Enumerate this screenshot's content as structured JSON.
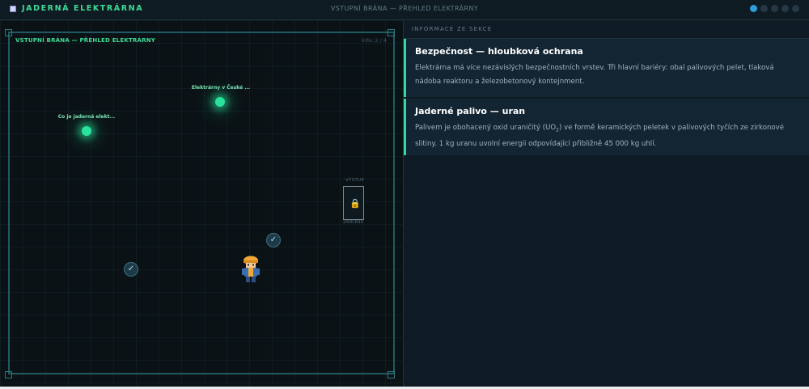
{
  "header": {
    "brand": "JADERNÁ ELEKTRÁRNA",
    "center_title": "VSTUPNÍ BRÁNA — PŘEHLED ELEKTRÁRNY",
    "progress_dots_total": 5,
    "progress_dots_active": 1
  },
  "game": {
    "arena_title": "VSTUPNÍ BRÁNA — PŘEHLED ELEKTRÁRNY",
    "info_label": "Info:",
    "info_count": "2 / 4",
    "nodes": [
      {
        "label": "Co je jaderná elekt...",
        "state": "active"
      },
      {
        "label": "Elektrárny v České ...",
        "state": "active"
      }
    ],
    "completed_markers": 2,
    "exit": {
      "label": "VÝSTUP",
      "status": "ZAMČENO",
      "icon": "lock-icon"
    },
    "player_icon": "worker-avatar"
  },
  "panel": {
    "header": "INFORMACE ZE SEKCE",
    "cards": [
      {
        "title": "Bezpečnost — hloubková ochrana",
        "body": "Elektrárna má více nezávislých bezpečnostních vrstev. Tři hlavní bariéry: obal palivových pelet, tlaková nádoba reaktoru a železobetonový kontejnment."
      },
      {
        "title": "Jaderné palivo — uran",
        "body_pre": "Palivem je obohacený oxid uraničitý (UO",
        "body_sub": "2",
        "body_post": ") ve formě keramických peletek v palivových tyčích ze zirkonové slitiny. 1 kg uranu uvolní energii odpovídající přibližně 45 000 kg uhlí."
      }
    ]
  },
  "colors": {
    "accent": "#3ddc97",
    "orb": "#29e39c",
    "dot_active": "#2a9fd8",
    "lock": "#f0b429"
  }
}
